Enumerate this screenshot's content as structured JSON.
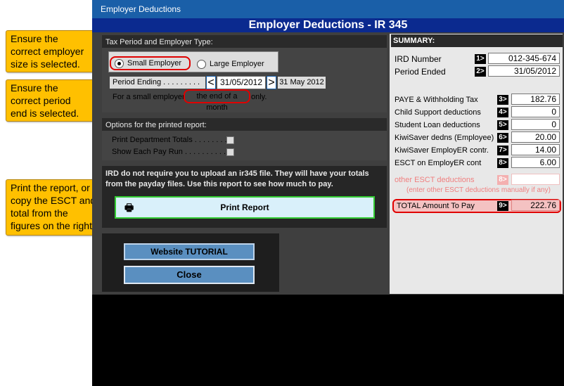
{
  "window": {
    "title": "Employer Deductions",
    "banner": "Employer Deductions - IR 345"
  },
  "callouts": {
    "employer_size": "Ensure the correct employer size is selected.",
    "period_end": "Ensure the correct period end is selected.",
    "print": "Print the report, or copy the ESCT and total from the figures on the right."
  },
  "tax_period": {
    "header": "Tax Period and Employer Type:",
    "small_employer": "Small Employer",
    "large_employer": "Large Employer",
    "period_label": "Period Ending . . . . . . . . .",
    "prev": "<",
    "date": "31/05/2012",
    "next": ">",
    "date_long": "31 May 2012",
    "note_pre": "For a small employer",
    "note_hl": "the end of a month",
    "note_post": "only."
  },
  "options": {
    "header": "Options for the printed report:",
    "print_totals": "Print Department Totals . . . . . . . .",
    "show_pay_run": "Show Each Pay Run . . . . . . . . . ."
  },
  "info": {
    "text": "IRD do not require you to upload an ir345 file. They will have your totals from the payday files. Use this report to see how much to pay.",
    "print_button": "Print Report"
  },
  "buttons": {
    "tutorial": "Website TUTORIAL",
    "close": "Close"
  },
  "summary": {
    "header": "SUMMARY:",
    "ird_label": "IRD Number",
    "ird_num": "1>",
    "ird_value": "012-345-674",
    "period_label": "Period Ended",
    "period_num": "2>",
    "period_value": "31/05/2012",
    "rows": [
      {
        "label": "PAYE & Withholding Tax",
        "num": "3>",
        "value": "182.76"
      },
      {
        "label": "Child Support deductions",
        "num": "4>",
        "value": "0"
      },
      {
        "label": "Student Loan deductions",
        "num": "5>",
        "value": "0"
      },
      {
        "label": "KiwiSaver dedns (Employee)",
        "num": "6>",
        "value": "20.00"
      },
      {
        "label": "KiwiSaver EmployER contr.",
        "num": "7>",
        "value": "14.00"
      },
      {
        "label": "ESCT on EmployER cont",
        "num": "8>",
        "value": "6.00"
      }
    ],
    "other_label": "other ESCT deductions",
    "other_num": "8>",
    "other_note": "(enter other ESCT deductions manually if any)",
    "total_label": "TOTAL Amount To Pay",
    "total_num": "9>",
    "total_value": "222.76"
  }
}
